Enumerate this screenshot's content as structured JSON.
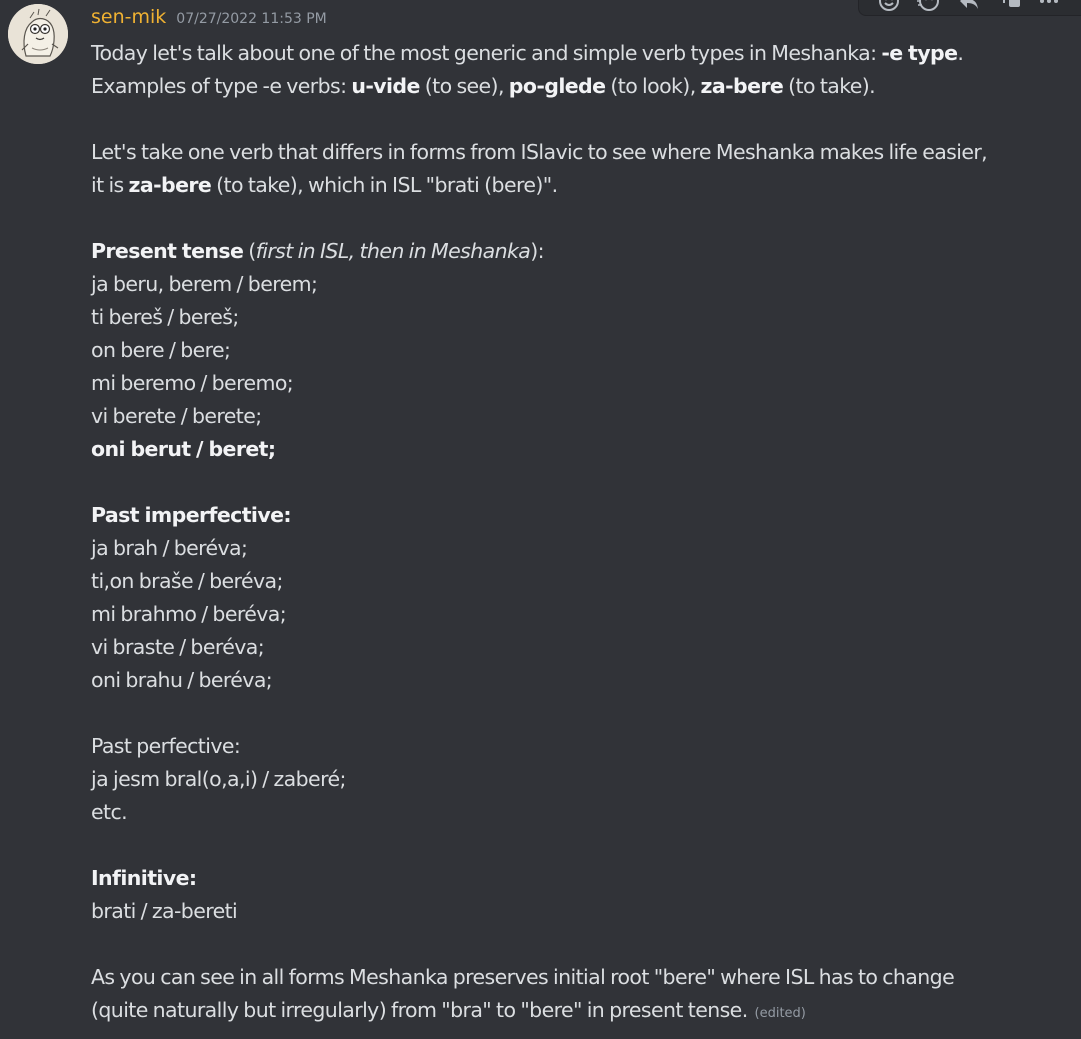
{
  "message": {
    "author": "sen-mik",
    "timestamp": "07/27/2022 11:53 PM",
    "edited_label": "(edited)",
    "lines": [
      [
        {
          "t": "Today let's talk about one of the most generic and simple verb types in Meshanka: "
        },
        {
          "t": "-e type",
          "b": true
        },
        {
          "t": "."
        }
      ],
      [
        {
          "t": "Examples of type -e verbs: "
        },
        {
          "t": "u-vide",
          "b": true
        },
        {
          "t": " (to see), "
        },
        {
          "t": "po-glede",
          "b": true
        },
        {
          "t": " (to look), "
        },
        {
          "t": "za-bere",
          "b": true
        },
        {
          "t": " (to take)."
        }
      ],
      [],
      [
        {
          "t": "Let's take one verb that differs in forms from ISlavic to see where Meshanka makes life easier,"
        }
      ],
      [
        {
          "t": "it is "
        },
        {
          "t": "za-bere",
          "b": true
        },
        {
          "t": " (to take), which in ISL \"brati (bere)\"."
        }
      ],
      [],
      [
        {
          "t": "Present tense",
          "b": true
        },
        {
          "t": " ("
        },
        {
          "t": "first in ISL, then in Meshanka",
          "i": true
        },
        {
          "t": "):"
        }
      ],
      [
        {
          "t": "ja beru, berem / berem;"
        }
      ],
      [
        {
          "t": "ti bereš / bereš;"
        }
      ],
      [
        {
          "t": "on bere / bere;"
        }
      ],
      [
        {
          "t": "mi beremo / beremo;"
        }
      ],
      [
        {
          "t": "vi berete / berete;"
        }
      ],
      [
        {
          "t": "oni berut / beret;",
          "b": true
        }
      ],
      [],
      [
        {
          "t": "Past imperfective:",
          "b": true
        }
      ],
      [
        {
          "t": "ja brah / beréva;"
        }
      ],
      [
        {
          "t": "ti,on braše / beréva;"
        }
      ],
      [
        {
          "t": "mi brahmo / beréva;"
        }
      ],
      [
        {
          "t": "vi braste / beréva;"
        }
      ],
      [
        {
          "t": "oni brahu / beréva;"
        }
      ],
      [],
      [
        {
          "t": "Past perfective:"
        }
      ],
      [
        {
          "t": "ja jesm bral(o,a,i) / zaberé;"
        }
      ],
      [
        {
          "t": "etc."
        }
      ],
      [],
      [
        {
          "t": "Infinitive:",
          "b": true
        }
      ],
      [
        {
          "t": "brati / za-bereti"
        }
      ],
      [],
      [
        {
          "t": "As you can see in all forms Meshanka preserves initial root \"bere\" where ISL has to change"
        }
      ],
      [
        {
          "t": "(quite naturally but irregularly) from \"bra\" to \"bere\" in present tense. "
        }
      ]
    ]
  },
  "toolbar": {
    "icons": [
      "add-reaction-icon",
      "super-reaction-icon",
      "reply-icon",
      "create-thread-icon",
      "more-icon"
    ]
  },
  "colors": {
    "background": "#313338",
    "username": "#f0b232",
    "text": "#dbdee1",
    "muted": "#949ba4"
  }
}
